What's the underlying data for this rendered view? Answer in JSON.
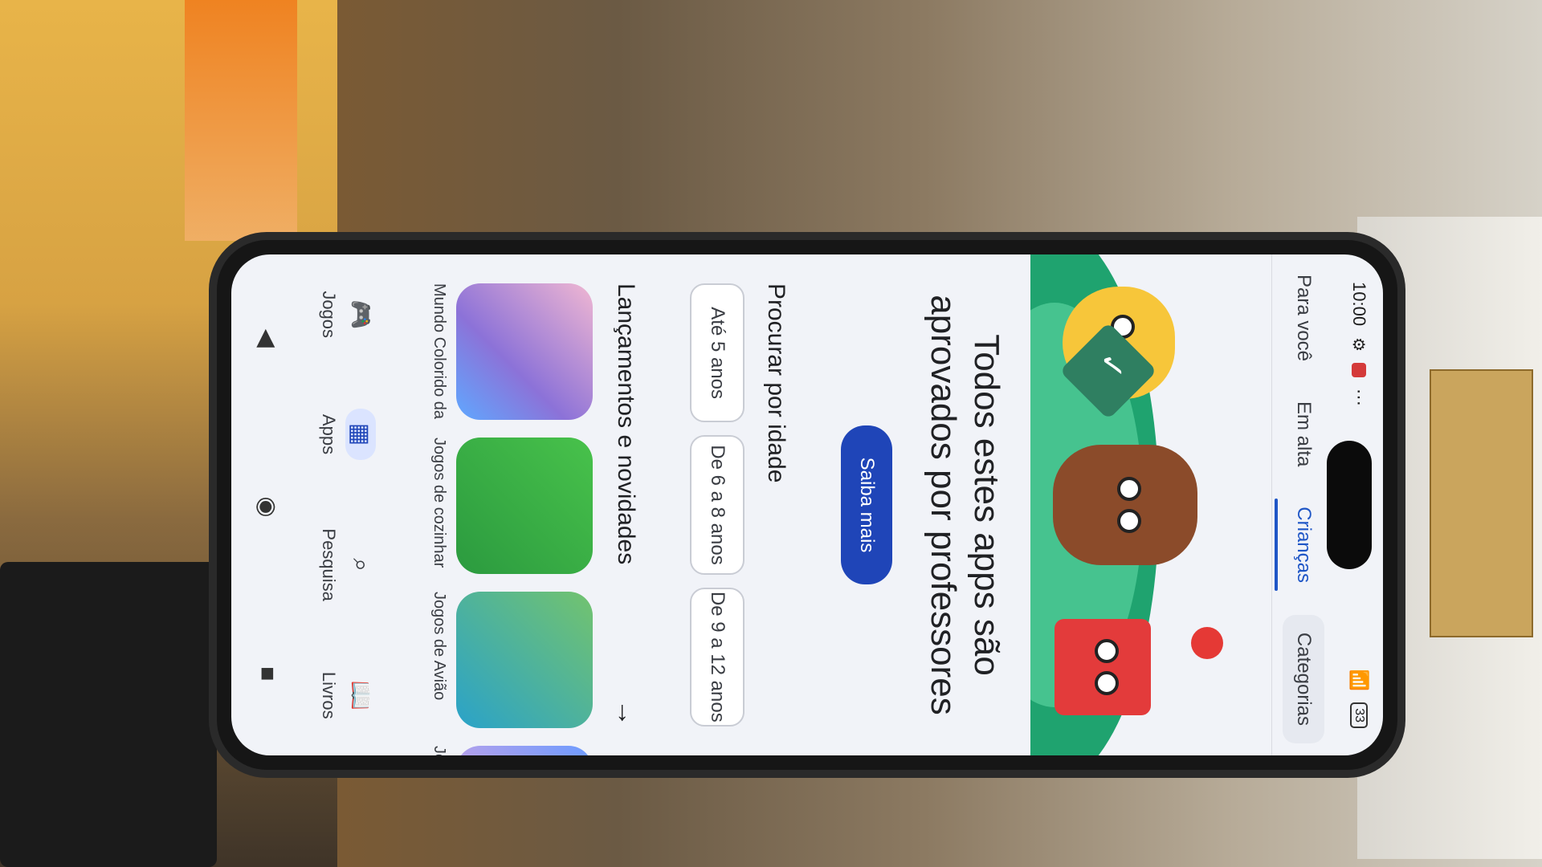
{
  "status": {
    "time": "10:00",
    "battery": "33"
  },
  "tabs": [
    {
      "label": "Para você"
    },
    {
      "label": "Em alta"
    },
    {
      "label": "Crianças"
    },
    {
      "label": "Categorias"
    }
  ],
  "hero": {
    "headline": "Todos estes apps são aprovados por professores",
    "cta": "Saiba mais"
  },
  "age": {
    "title": "Procurar por idade",
    "chips": [
      "Até 5 anos",
      "De 6 a 8 anos",
      "De 9 a 12 anos"
    ]
  },
  "new_releases": {
    "title": "Lançamentos e novidades",
    "apps": [
      {
        "title": "Mundo Colorido da"
      },
      {
        "title": "Jogos de cozinhar"
      },
      {
        "title": "Jogos de Avião"
      },
      {
        "title": "Jo"
      }
    ]
  },
  "bottom_nav": [
    {
      "label": "Jogos",
      "icon": "gamepad-icon"
    },
    {
      "label": "Apps",
      "icon": "apps-grid-icon"
    },
    {
      "label": "Pesquisa",
      "icon": "search-icon"
    },
    {
      "label": "Livros",
      "icon": "book-icon"
    }
  ],
  "system_nav": {
    "back": "back-icon",
    "home": "home-icon",
    "recents": "recents-icon"
  }
}
